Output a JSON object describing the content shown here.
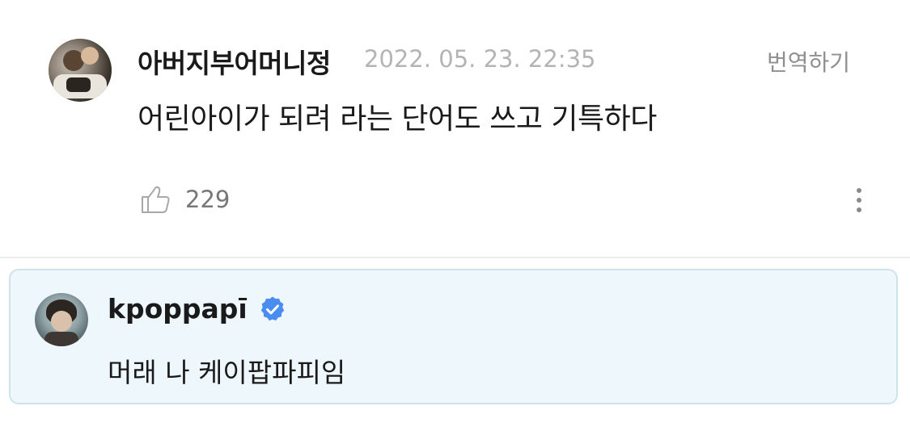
{
  "comment": {
    "author": "아버지부어머니정",
    "timestamp": "2022. 05. 23. 22:35",
    "translate_label": "번역하기",
    "text": "어린아이가 되려 라는 단어도 쓰고 기특하다",
    "like_count": "229",
    "icons": {
      "like": "thumbs-up-icon",
      "more": "more-vertical-icon"
    }
  },
  "reply": {
    "author": "kpoppapī",
    "verified": true,
    "text": "머래 나 케이팝파피임",
    "icons": {
      "verified": "verified-badge-icon"
    }
  },
  "colors": {
    "reply_background": "#eef7fc",
    "reply_border": "#cfe3ec",
    "verified_blue": "#4a8df0",
    "muted_text": "#b4b4b4"
  }
}
